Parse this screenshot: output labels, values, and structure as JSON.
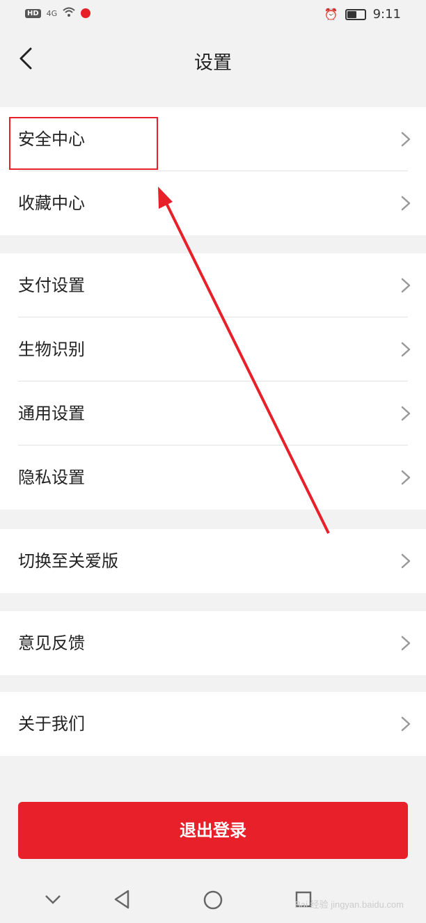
{
  "status_bar": {
    "network_badge": "HD",
    "signal": "4G",
    "time": "9:11",
    "battery_percent": 60
  },
  "nav": {
    "title": "设置",
    "back_icon": "chevron-left-icon"
  },
  "groups": [
    {
      "items": [
        {
          "label": "安全中心"
        },
        {
          "label": "收藏中心"
        }
      ]
    },
    {
      "items": [
        {
          "label": "支付设置"
        },
        {
          "label": "生物识别"
        },
        {
          "label": "通用设置"
        },
        {
          "label": "隐私设置"
        }
      ]
    },
    {
      "items": [
        {
          "label": "切换至关爱版"
        }
      ]
    },
    {
      "items": [
        {
          "label": "意见反馈"
        }
      ]
    },
    {
      "items": [
        {
          "label": "关于我们"
        }
      ]
    }
  ],
  "logout_label": "退出登录",
  "watermark": "Bai 经验 jingyan.baidu.com",
  "colors": {
    "accent": "#e8202a",
    "background": "#f2f2f2",
    "row_bg": "#ffffff",
    "text": "#222222"
  }
}
